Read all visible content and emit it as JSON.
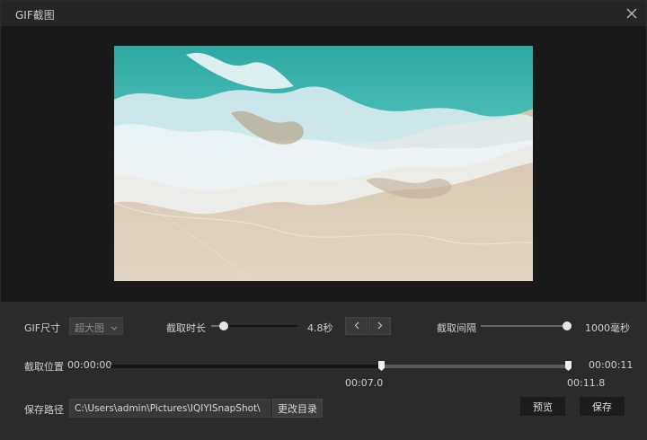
{
  "window": {
    "title": "GIF截图"
  },
  "size": {
    "label": "GIF尺寸",
    "selected": "超大图"
  },
  "duration": {
    "label": "截取时长",
    "value": "4.8秒",
    "fraction": 0.15
  },
  "interval": {
    "label": "截取间隔",
    "value": "1000毫秒",
    "fraction": 1.0
  },
  "position": {
    "label": "截取位置",
    "start_time": "00:00:00",
    "end_time": "00:00:11",
    "start_marker": "00:07.0",
    "end_marker": "00:11.8",
    "start_fraction": 0.585,
    "end_fraction": 0.99
  },
  "save": {
    "label": "保存路径",
    "path": "C:\\Users\\admin\\Pictures\\IQIYISnapShot\\",
    "change_dir": "更改目录",
    "preview": "预览",
    "save": "保存"
  },
  "colors": {
    "sea": "#3fb8b0",
    "foam": "#dbe9ef",
    "sand": "#d9cbb5"
  }
}
